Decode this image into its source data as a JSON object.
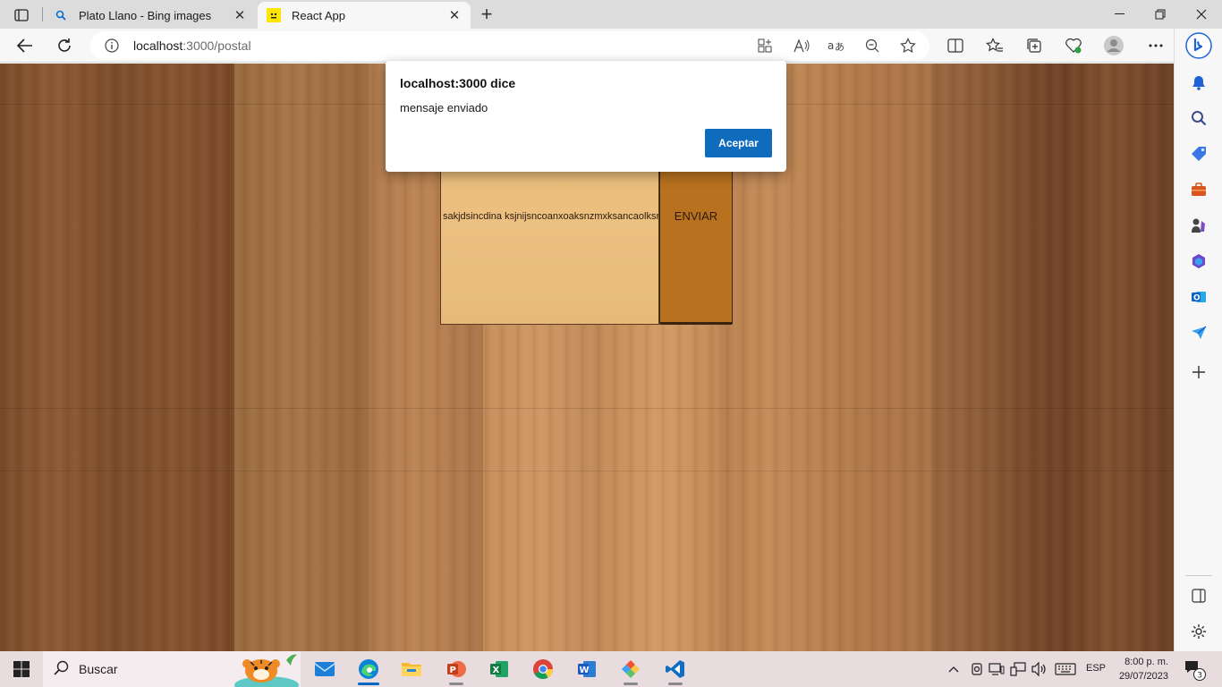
{
  "browser": {
    "tabs": [
      {
        "title": "Plato Llano - Bing images",
        "favicon": "bing-search-icon",
        "active": false
      },
      {
        "title": "React App",
        "favicon": "react-app-favicon",
        "active": true
      }
    ],
    "address_bar": {
      "host": "localhost",
      "rest": ":3000/postal"
    }
  },
  "page": {
    "postal_text": "sakjdsincdina ksjnijsncoanxoaksnzmxksancaolksncaksnc",
    "send_label": "ENVIAR"
  },
  "dialog": {
    "title": "localhost:3000 dice",
    "message": "mensaje enviado",
    "ok_label": "Aceptar"
  },
  "taskbar": {
    "search_label": "Buscar",
    "apps": [
      "mail",
      "edge",
      "file-explorer",
      "powerpoint",
      "excel",
      "chrome",
      "word",
      "git-kraken",
      "vscode"
    ],
    "language": "ESP",
    "time": "8:00 p. m.",
    "date": "29/07/2023",
    "notification_count": "3"
  },
  "colors": {
    "accent": "#0f6cbd",
    "postal_card": "#eabd7c",
    "send_button": "#b8711e"
  }
}
